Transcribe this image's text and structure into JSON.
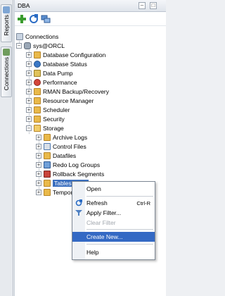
{
  "side_tabs": {
    "reports": "Reports",
    "connections": "Connections"
  },
  "panel": {
    "title": "DBA",
    "minimize_glyph": "–",
    "maximize_glyph": "□"
  },
  "toolbar": {
    "add_icon": "plus-icon",
    "refresh_icon": "refresh-icon",
    "filter_icon": "connection-filter-icon"
  },
  "tree": {
    "collapse_glyph": "−",
    "expand_glyph": "+",
    "root": "Connections",
    "connection": "sys@ORCL",
    "nodes": [
      "Database Configuration",
      "Database Status",
      "Data Pump",
      "Performance",
      "RMAN Backup/Recovery",
      "Resource Manager",
      "Scheduler",
      "Security",
      "Storage"
    ],
    "storage_children": [
      "Archive Logs",
      "Control Files",
      "Datafiles",
      "Redo Log Groups",
      "Rollback Segments",
      "Tablespaces",
      "Temporary Tablespace Groups"
    ]
  },
  "context_menu": {
    "open": "Open",
    "refresh": "Refresh",
    "refresh_shortcut": "Ctrl-R",
    "apply_filter": "Apply Filter...",
    "clear_filter": "Clear Filter",
    "create_new": "Create New...",
    "help": "Help"
  },
  "colors": {
    "selection": "#3b6fbf",
    "menu_hover": "#3469c4",
    "folder": "#e9b94a"
  }
}
